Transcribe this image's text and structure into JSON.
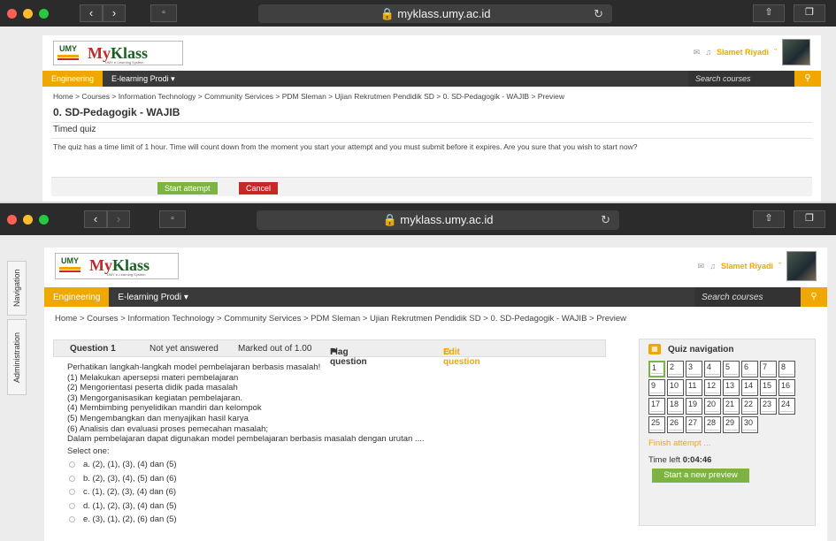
{
  "browser": {
    "url": "myklass.umy.ac.id"
  },
  "site": {
    "logo_umy": "UMY",
    "logo_name_prefix": "My",
    "logo_name_suffix": "Klass",
    "logo_tagline": "UMY e-Learning System",
    "user_name": "Slamet Riyadi",
    "nav_engineering": "Engineering",
    "nav_prodi": "E-learning Prodi",
    "search_placeholder": "Search courses"
  },
  "window1": {
    "breadcrumb": "Home > Courses > Information Technology > Community Services > PDM Sleman > Ujian Rekrutmen Pendidik SD > 0. SD-Pedagogik - WAJIB > Preview",
    "page_title": "0. SD-Pedagogik - WAJIB",
    "section_title": "Timed quiz",
    "notice": "The quiz has a time limit of 1 hour. Time will count down from the moment you start your attempt and you must submit before it expires. Are you sure that you wish to start now?",
    "start_button": "Start attempt",
    "cancel_button": "Cancel"
  },
  "window2": {
    "breadcrumb": "Home > Courses > Information Technology > Community Services > PDM Sleman > Ujian Rekrutmen Pendidik SD > 0. SD-Pedagogik - WAJIB > Preview",
    "side_tabs": [
      "Navigation",
      "Administration"
    ],
    "question": {
      "number": "Question 1",
      "state": "Not yet answered",
      "marks": "Marked out of 1.00",
      "flag": "Flag question",
      "edit": "Edit question",
      "text_lines": [
        "Perhatikan langkah-langkah model pembelajaran berbasis masalah!",
        "(1) Melakukan apersepsi materi pembelajaran",
        "(2) Mengorientasi peserta didik pada masalah",
        "(3) Mengorganisasikan kegiatan pembelajaran.",
        "(4) Membimbing penyelidikan mandiri dan kelompok",
        "(5) Mengembangkan dan menyajikan hasil karya",
        "(6) Analisis dan evaluasi proses pemecahan masalah;",
        "Dalam pembelajaran dapat digunakan model pembelajaran berbasis masalah dengan urutan ...."
      ],
      "select_label": "Select one:",
      "options": [
        "a. (2), (1), (3), (4) dan (5)",
        "b. (2), (3), (4), (5) dan (6)",
        "c. (1), (2), (3), (4) dan (6)",
        "d. (1), (2), (3), (4) dan (5)",
        "e. (3), (1), (2), (6) dan (5)"
      ]
    },
    "quiz_nav": {
      "title": "Quiz navigation",
      "cells": [
        "1",
        "2",
        "3",
        "4",
        "5",
        "6",
        "7",
        "8",
        "9",
        "10",
        "11",
        "12",
        "13",
        "14",
        "15",
        "16",
        "17",
        "18",
        "19",
        "20",
        "21",
        "22",
        "23",
        "24",
        "25",
        "26",
        "27",
        "28",
        "29",
        "30"
      ],
      "finish": "Finish attempt ...",
      "time_label": "Time left",
      "time_value": "0:04:46",
      "preview_button": "Start a new preview"
    }
  }
}
